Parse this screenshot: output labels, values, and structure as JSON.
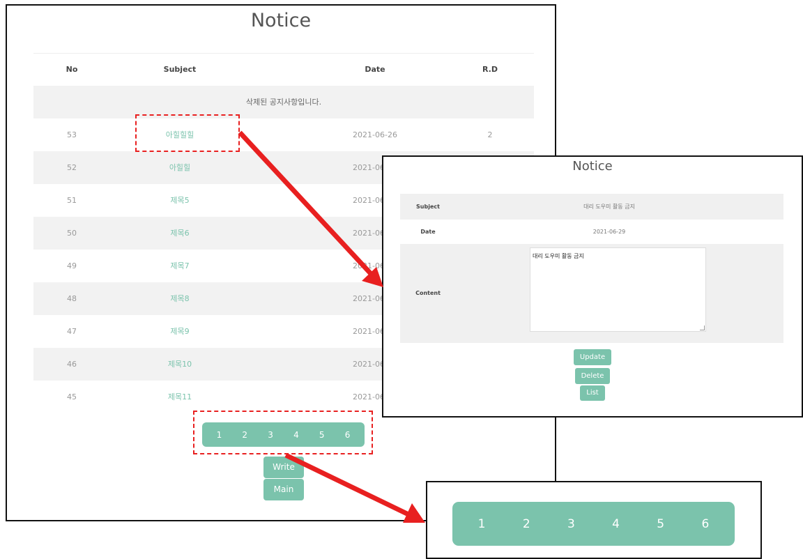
{
  "list": {
    "title": "Notice",
    "headers": {
      "no": "No",
      "subject": "Subject",
      "date": "Date",
      "rd": "R.D"
    },
    "deleted_message": "삭제된 공지사항입니다.",
    "rows": [
      {
        "no": "53",
        "subject": "아힐힐힐",
        "date": "2021-06-26",
        "rd": "2"
      },
      {
        "no": "52",
        "subject": "아힐힐",
        "date": "2021-06-26",
        "rd": ""
      },
      {
        "no": "51",
        "subject": "제목5",
        "date": "2021-06-26",
        "rd": ""
      },
      {
        "no": "50",
        "subject": "제목6",
        "date": "2021-06-26",
        "rd": ""
      },
      {
        "no": "49",
        "subject": "제목7",
        "date": "2021-06-26",
        "rd": ""
      },
      {
        "no": "48",
        "subject": "제목8",
        "date": "2021-06-26",
        "rd": ""
      },
      {
        "no": "47",
        "subject": "제목9",
        "date": "2021-06-26",
        "rd": ""
      },
      {
        "no": "46",
        "subject": "제목10",
        "date": "2021-06-26",
        "rd": ""
      },
      {
        "no": "45",
        "subject": "제목11",
        "date": "2021-06-26",
        "rd": ""
      }
    ],
    "pages": [
      "1",
      "2",
      "3",
      "4",
      "5",
      "6"
    ],
    "write_label": "Write",
    "main_label": "Main"
  },
  "detail": {
    "title": "Notice",
    "subject_label": "Subject",
    "subject_value": "대리 도우미 활동 금지",
    "date_label": "Date",
    "date_value": "2021-06-29",
    "content_label": "Content",
    "content_value": "대리 도우미 활동 금지",
    "update_label": "Update",
    "delete_label": "Delete",
    "list_label": "List"
  },
  "zoom": {
    "pages": [
      "1",
      "2",
      "3",
      "4",
      "5",
      "6"
    ]
  },
  "colors": {
    "accent": "#7bc3ac",
    "annotation": "#e82020"
  }
}
